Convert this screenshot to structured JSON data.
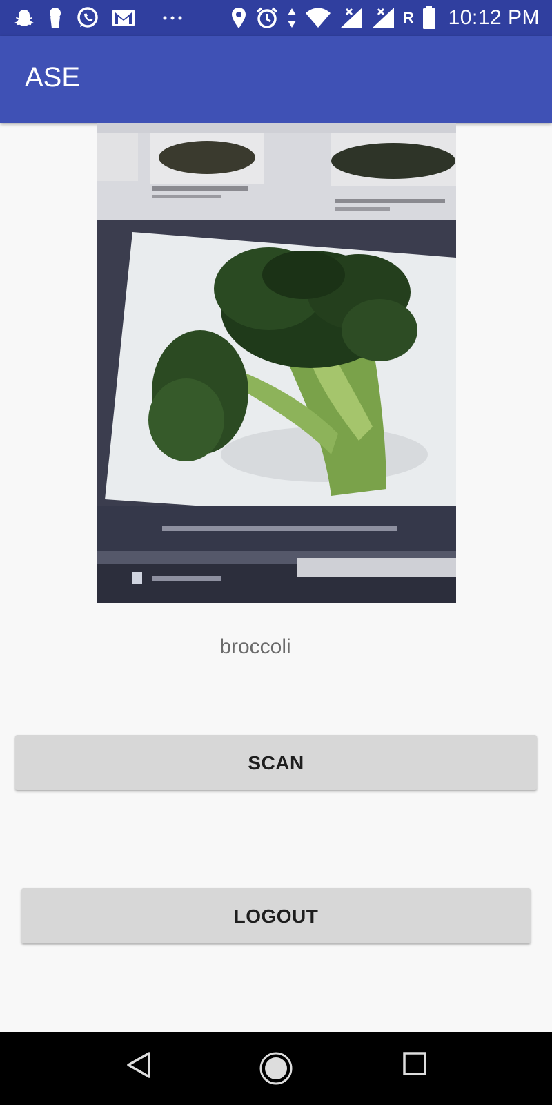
{
  "status_bar": {
    "left_icons": [
      "snapchat-icon",
      "keyhole-icon",
      "whatsapp-icon",
      "gmail-icon",
      "more-notifications-icon"
    ],
    "right_icons": [
      "location-icon",
      "alarm-icon",
      "data-arrows-icon",
      "wifi-icon",
      "signal-icon",
      "signal-icon"
    ],
    "roaming": "R",
    "battery_icon": "battery-icon",
    "time": "10:12 PM"
  },
  "app_bar": {
    "title": "ASE",
    "color": "#3f51b5",
    "status_color": "#303f9f"
  },
  "main": {
    "photo_alt": "photo-of-screen-showing-broccoli",
    "prediction": "broccoli",
    "scan_label": "SCAN",
    "logout_label": "LOGOUT"
  },
  "nav_bar": {
    "icons": [
      "back-icon",
      "home-icon",
      "recents-icon"
    ]
  }
}
